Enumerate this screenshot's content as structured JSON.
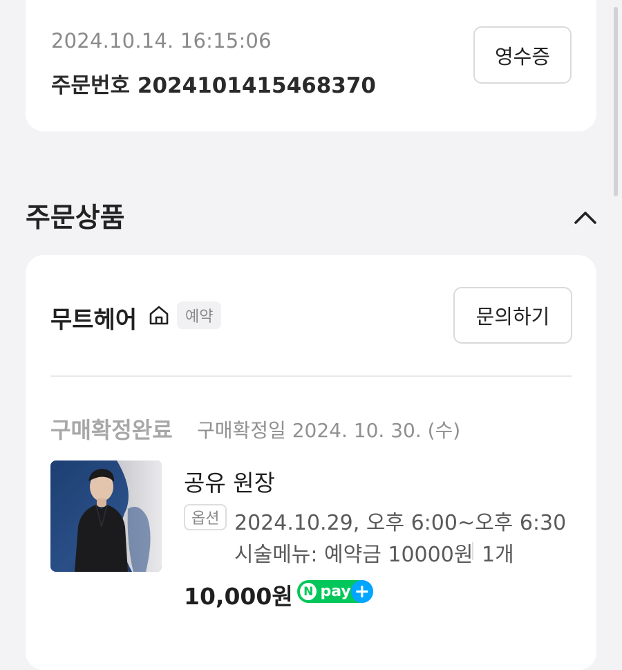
{
  "order": {
    "datetime": "2024.10.14. 16:15:06",
    "order_number": "주문번호 2024101415468370",
    "receipt_label": "영수증"
  },
  "section": {
    "title": "주문상품",
    "collapse_icon": "chevron-up-icon"
  },
  "shop": {
    "name": "무트헤어",
    "home_icon": "home-icon",
    "badge": "예약",
    "inquiry_label": "문의하기"
  },
  "status": {
    "main": "구매확정완료",
    "sub": "구매확정일 2024. 10. 30. (수)"
  },
  "product": {
    "name": "공유 원장",
    "option_badge": "옵션",
    "option_datetime": "2024.10.29, 오후 6:00~오후 6:30",
    "option_menu": "시술메뉴: 예약금 10000원",
    "quantity": "1개",
    "price": "10,000원"
  },
  "npay": {
    "n": "N",
    "text": "pay",
    "plus": "+"
  },
  "colors": {
    "background": "#f3f3f5",
    "card": "#ffffff",
    "npay_green": "#03c75a",
    "npay_blue": "#00a6ff"
  }
}
